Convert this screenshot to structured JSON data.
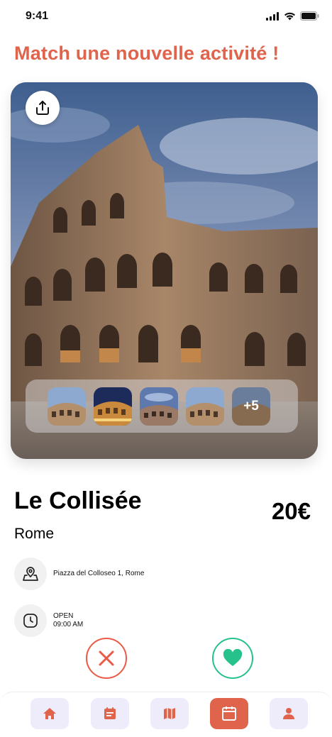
{
  "status_bar": {
    "time": "9:41"
  },
  "header": {
    "title": "Match une nouvelle activité !"
  },
  "hero": {
    "thumbnails": [
      {
        "icon": "colosseum-day"
      },
      {
        "icon": "colosseum-night"
      },
      {
        "icon": "colosseum-dusk"
      },
      {
        "icon": "colosseum-day"
      },
      {
        "icon": "colosseum-day"
      }
    ],
    "more_count": "+5"
  },
  "activity": {
    "name": "Le Collisée",
    "price": "20€",
    "city": "Rome",
    "address": "Piazza del Colloseo 1, Rome",
    "status": "OPEN",
    "hours": "09:00 AM"
  },
  "nav": {
    "items": [
      {
        "icon": "home-icon"
      },
      {
        "icon": "list-calendar-icon"
      },
      {
        "icon": "map-icon"
      },
      {
        "icon": "calendar-icon",
        "active": true
      },
      {
        "icon": "user-icon"
      }
    ]
  },
  "colors": {
    "accent": "#e0634c",
    "reject": "#ea5a47",
    "like": "#27c18b",
    "nav_bg": "#eeecfb"
  }
}
